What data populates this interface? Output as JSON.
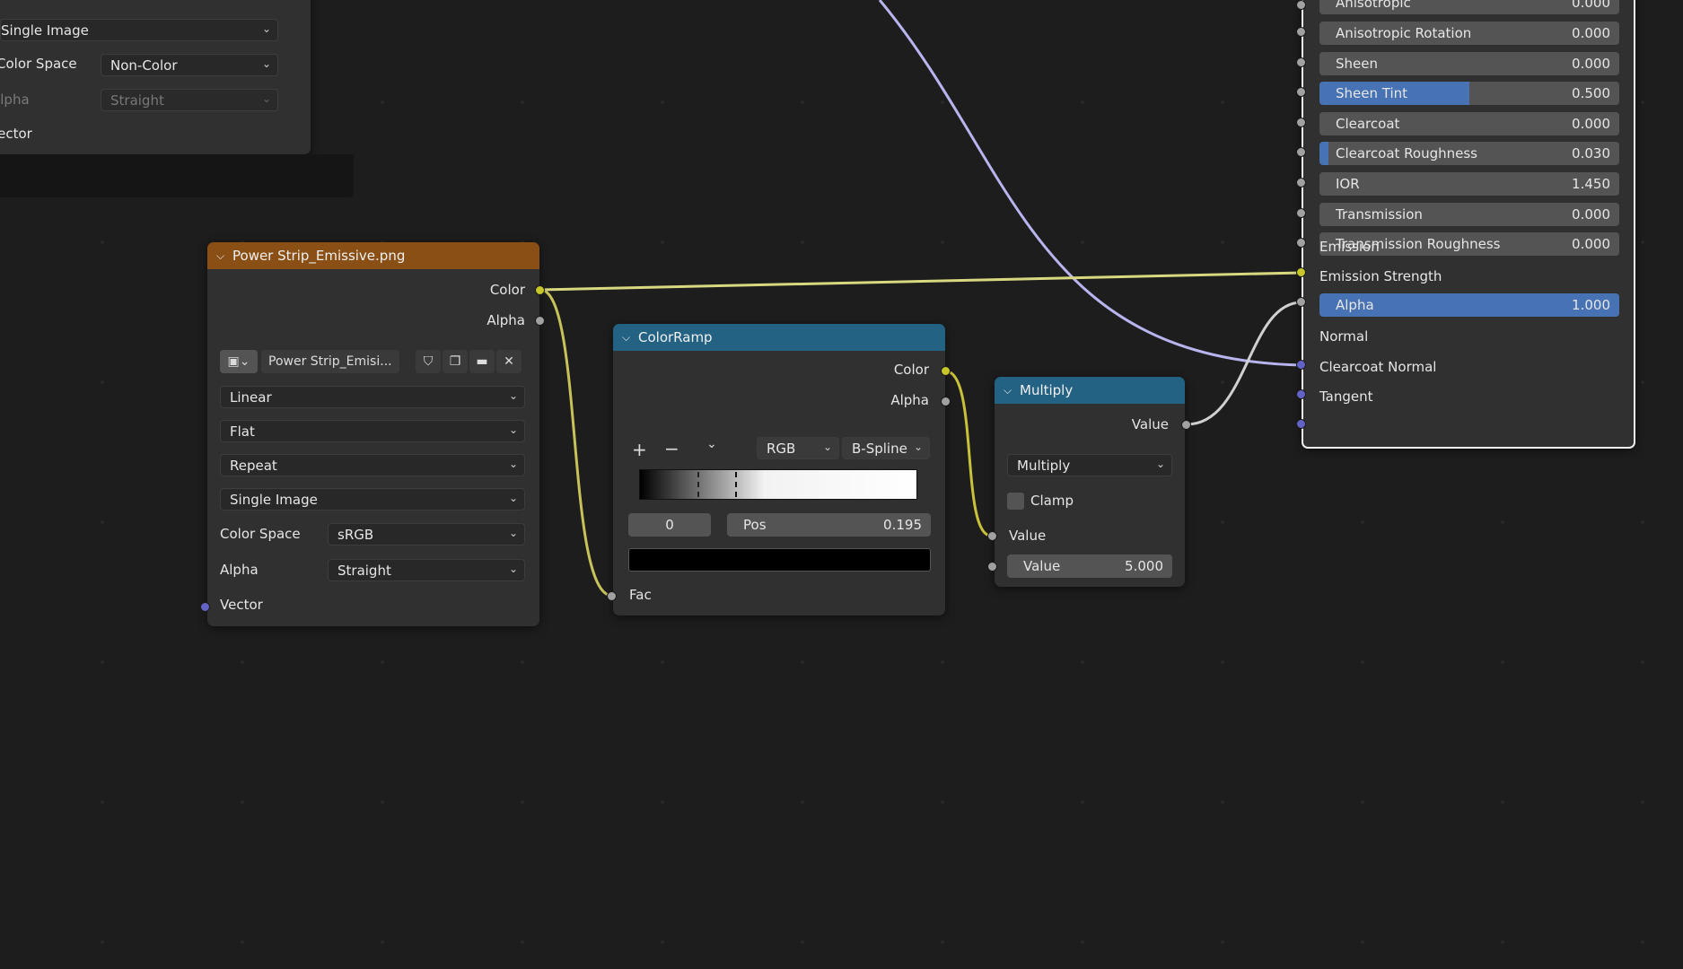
{
  "top_left_node": {
    "source_value": "Single Image",
    "color_space_label": "Color Space",
    "color_space_value": "Non-Color",
    "alpha_label": "Alpha",
    "alpha_value": "Straight",
    "vector_label": "Vector"
  },
  "image_node": {
    "title": "Power Strip_Emissive.png",
    "header_color": "#8a4f14",
    "outputs": {
      "color": "Color",
      "alpha": "Alpha"
    },
    "image_name": "Power Strip_Emisi...",
    "interpolation": "Linear",
    "projection": "Flat",
    "extension": "Repeat",
    "source": "Single Image",
    "color_space_label": "Color Space",
    "color_space_value": "sRGB",
    "alpha_label": "Alpha",
    "alpha_value": "Straight",
    "vector_label": "Vector"
  },
  "colorramp_node": {
    "title": "ColorRamp",
    "header_color": "#246283",
    "outputs": {
      "color": "Color",
      "alpha": "Alpha"
    },
    "add_symbol": "+",
    "remove_symbol": "−",
    "color_mode": "RGB",
    "interpolation": "B-Spline",
    "stop_index": "0",
    "pos_label": "Pos",
    "pos_value": "0.195",
    "input_label": "Fac"
  },
  "multiply_node": {
    "title": "Multiply",
    "header_color": "#246283",
    "output_label": "Value",
    "operation": "Multiply",
    "clamp_label": "Clamp",
    "input1_label": "Value",
    "input2_label": "Value",
    "input2_value": "5.000"
  },
  "bsdf_node": {
    "top_cut_label": "Anisotropic",
    "top_cut_value": "0.000",
    "rows": [
      {
        "label": "Anisotropic Rotation",
        "value": "0.000",
        "fill": 0.0
      },
      {
        "label": "Sheen",
        "value": "0.000",
        "fill": 0.0
      },
      {
        "label": "Sheen Tint",
        "value": "0.500",
        "fill": 0.5
      },
      {
        "label": "Clearcoat",
        "value": "0.000",
        "fill": 0.0
      },
      {
        "label": "Clearcoat Roughness",
        "value": "0.030",
        "fill": 0.03
      },
      {
        "label": "IOR",
        "value": "1.450",
        "fill": 0.0
      },
      {
        "label": "Transmission",
        "value": "0.000",
        "fill": 0.0
      },
      {
        "label": "Transmission Roughness",
        "value": "0.000",
        "fill": 0.0
      }
    ],
    "emission_label": "Emission",
    "emission_strength_label": "Emission Strength",
    "alpha_label": "Alpha",
    "alpha_value": "1.000",
    "alpha_fill": 1.0,
    "normal_label": "Normal",
    "clearcoat_normal_label": "Clearcoat Normal",
    "tangent_label": "Tangent"
  },
  "colors": {
    "wire_yellow": "#d8d880",
    "wire_gray": "#c8c8c8",
    "wire_lavender": "#b8b4ee",
    "field_fill": "#4772b3"
  }
}
